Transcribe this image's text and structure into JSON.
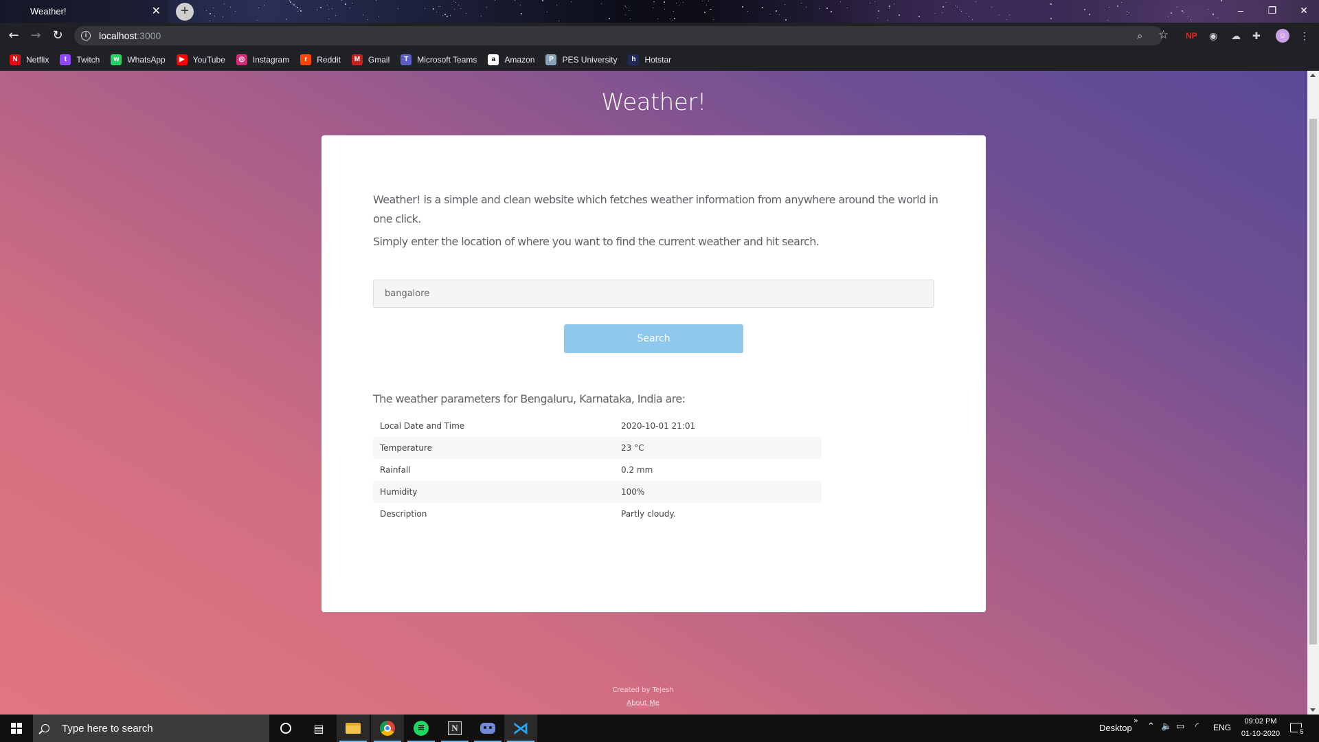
{
  "browser": {
    "tab_title": "Weather!",
    "tab_close": "✕",
    "new_tab": "+",
    "url_host": "localhost",
    "url_port": ":3000",
    "window_controls": {
      "minimize": "–",
      "maximize": "❐",
      "close": "✕"
    },
    "extension_badge": "NP"
  },
  "bookmarks": [
    {
      "label": "Netflix",
      "icon": "netflix-icon",
      "color": "#e50914",
      "glyph": "N"
    },
    {
      "label": "Twitch",
      "icon": "twitch-icon",
      "color": "#9146ff",
      "glyph": "t"
    },
    {
      "label": "WhatsApp",
      "icon": "whatsapp-icon",
      "color": "#25d366",
      "glyph": "w"
    },
    {
      "label": "YouTube",
      "icon": "youtube-icon",
      "color": "#ff0000",
      "glyph": "▶"
    },
    {
      "label": "Instagram",
      "icon": "instagram-icon",
      "color": "#d62976",
      "glyph": "◎"
    },
    {
      "label": "Reddit",
      "icon": "reddit-icon",
      "color": "#ff4500",
      "glyph": "r"
    },
    {
      "label": "Gmail",
      "icon": "gmail-icon",
      "color": "#c5221f",
      "glyph": "M"
    },
    {
      "label": "Microsoft Teams",
      "icon": "teams-icon",
      "color": "#5b5fc7",
      "glyph": "T"
    },
    {
      "label": "Amazon",
      "icon": "amazon-icon",
      "color": "#ffffff",
      "glyph": "a"
    },
    {
      "label": "PES University",
      "icon": "pes-icon",
      "color": "#8aa3b8",
      "glyph": "P"
    },
    {
      "label": "Hotstar",
      "icon": "hotstar-icon",
      "color": "#1f2a5a",
      "glyph": "h"
    }
  ],
  "page": {
    "title": "Weather!",
    "intro_1": "Weather! is a simple and clean website which fetches weather information from anywhere around the world in one click.",
    "intro_2": "Simply enter the location of where you want to find the current weather and hit search.",
    "search_value": "bangalore",
    "search_button": "Search",
    "results_heading": "The weather parameters for Bengaluru, Karnataka, India are:",
    "weather_rows": [
      {
        "label": "Local Date and Time",
        "value": "2020-10-01 21:01"
      },
      {
        "label": "Temperature",
        "value": "23 °C"
      },
      {
        "label": "Rainfall",
        "value": "0.2 mm"
      },
      {
        "label": "Humidity",
        "value": "100%"
      },
      {
        "label": "Description",
        "value": "Partly cloudy."
      }
    ],
    "footer_created": "Created by Tejesh",
    "footer_about": "About Me"
  },
  "taskbar": {
    "search_placeholder": "Type here to search",
    "desktop_label": "Desktop",
    "chevron": "»",
    "language": "ENG",
    "time": "09:02 PM",
    "date": "01-10-2020",
    "notification_count": "5"
  },
  "colors": {
    "gradient_start": "#e27680",
    "gradient_end": "#5a4a97",
    "search_button": "#8ec8ec",
    "taskbar": "#101010",
    "toolbar": "#202124"
  }
}
